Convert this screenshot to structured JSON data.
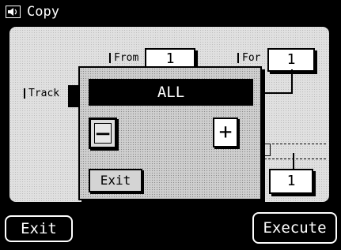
{
  "window": {
    "title": "Copy",
    "icon": "speaker-icon"
  },
  "fields": {
    "from_label": "From",
    "from_value": "1",
    "for_label": "For",
    "for_value": "1",
    "track_label": "Track",
    "lower_value": "1"
  },
  "popup": {
    "display_value": "ALL",
    "minus_label": "−",
    "plus_label": "+",
    "exit_label": "Exit"
  },
  "footer": {
    "exit_label": "Exit",
    "execute_label": "Execute"
  }
}
